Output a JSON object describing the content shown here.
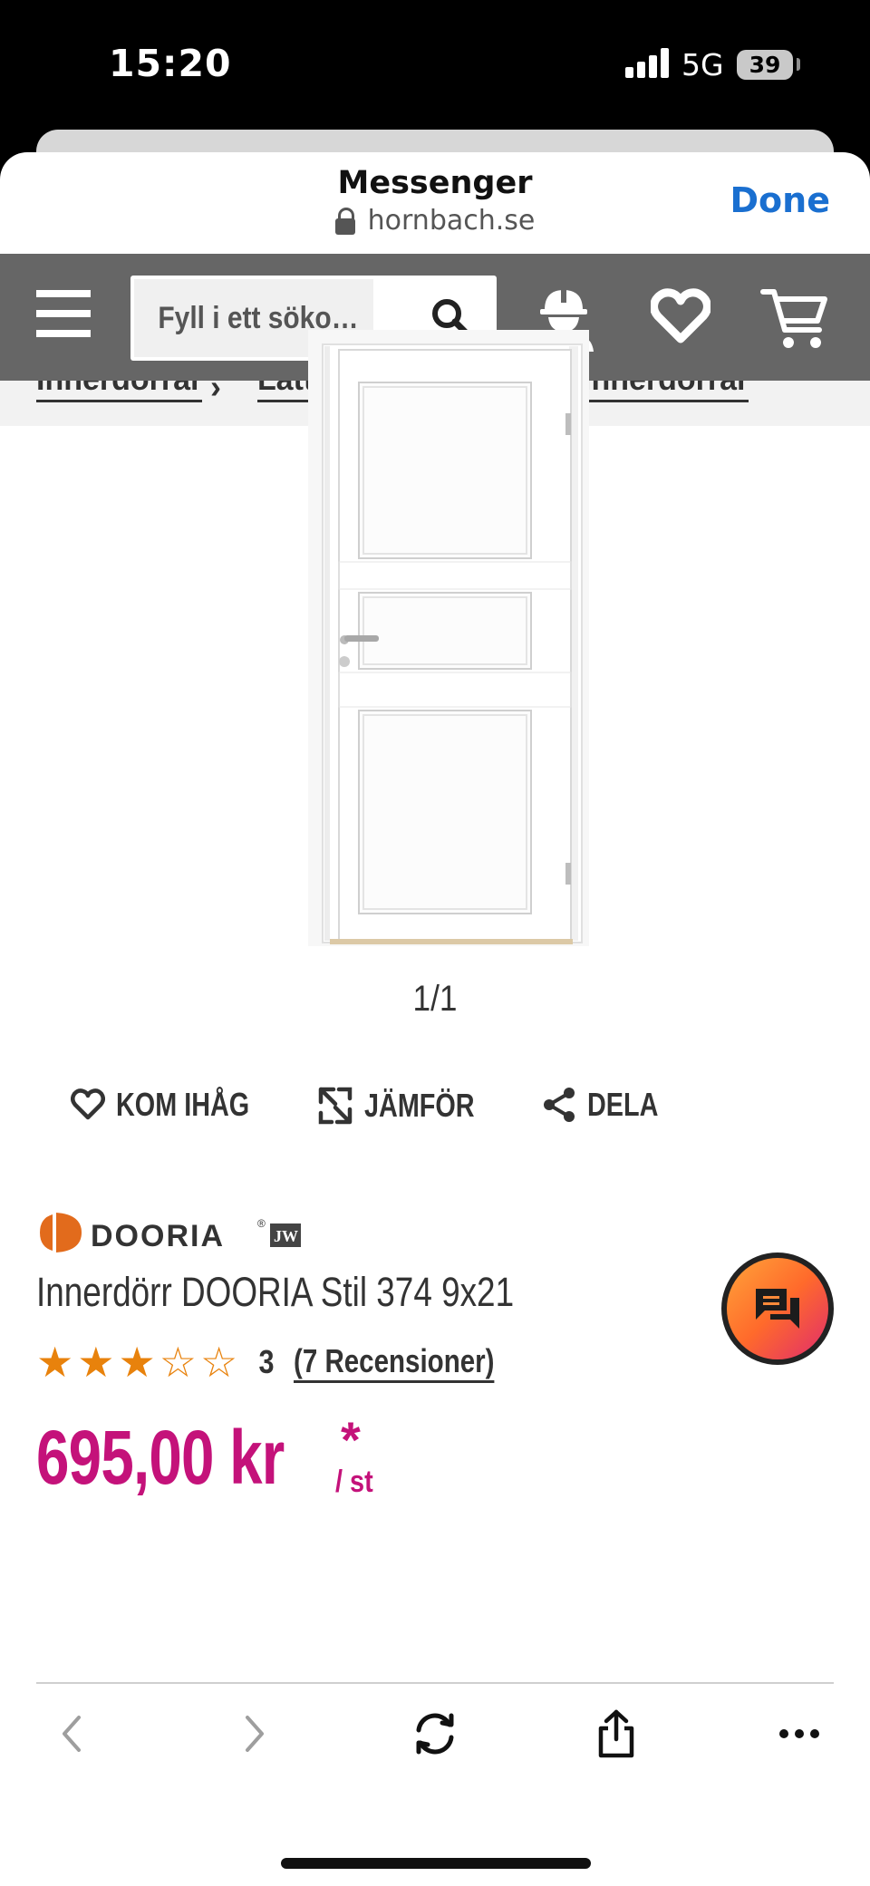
{
  "status_bar": {
    "time": "15:20",
    "network": "5G",
    "battery": "39"
  },
  "browser_header": {
    "app_title": "Messenger",
    "url": "hornbach.se",
    "done_label": "Done"
  },
  "site_nav": {
    "search_placeholder": "Fyll i ett söko…",
    "icons": [
      "menu-icon",
      "search-icon",
      "account-icon",
      "wishlist-heart-icon",
      "cart-icon"
    ]
  },
  "breadcrumb": {
    "items": [
      "Innerdörrar",
      "Lätta & formpressade innerdörrar"
    ]
  },
  "gallery": {
    "pager": "1/1"
  },
  "actions": {
    "remember": "KOM IHÅG",
    "compare": "JÄMFÖR",
    "share": "DELA"
  },
  "product": {
    "brand": "DOORIA",
    "name": "Innerdörr DOORIA Stil 374 9x21",
    "rating": 3,
    "rating_max": 5,
    "rating_text": "3",
    "reviews": "(7 Recensioner)",
    "price": "695,00 kr",
    "price_asterisk": "*",
    "price_unit": "/ st"
  },
  "colors": {
    "price": "#c4127a",
    "star": "#e8820c",
    "nav_bg": "#666666",
    "link_blue": "#1a6fd0"
  },
  "browser_toolbar": {
    "icons": [
      "back-icon",
      "forward-icon",
      "reload-icon",
      "share-icon",
      "more-icon"
    ]
  }
}
